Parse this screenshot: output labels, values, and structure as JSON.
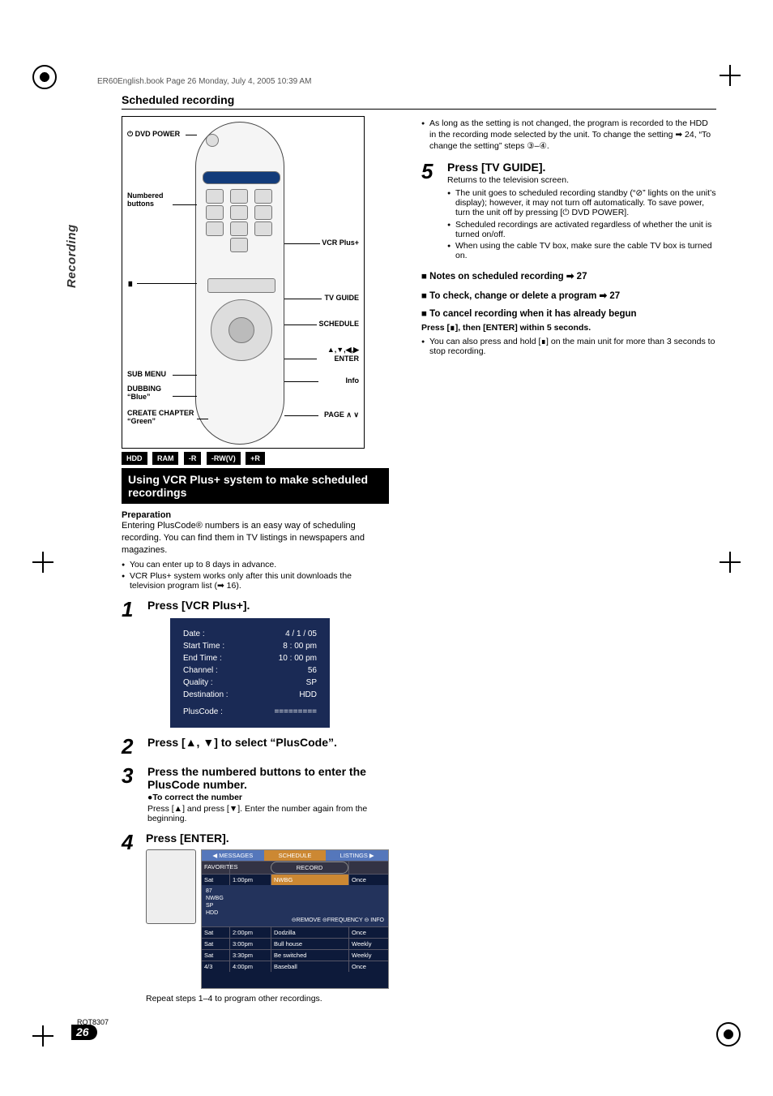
{
  "header_stamp": "ER60English.book  Page 26  Monday, July 4, 2005  10:39 AM",
  "side_tab": "Recording",
  "section_title": "Scheduled recording",
  "remote_labels": {
    "dvd_power": "⏻ DVD POWER",
    "numbered": "Numbered buttons",
    "vcrplus": "VCR Plus+",
    "stop_sym": "∎",
    "tvguide": "TV GUIDE",
    "schedule": "SCHEDULE",
    "arrows": "▲,▼,◀,▶\nENTER",
    "info": "Info",
    "submenu": "SUB MENU",
    "dubbing": "DUBBING\n“Blue”",
    "createch": "CREATE CHAPTER\n“Green”",
    "page": "PAGE ∧  ∨"
  },
  "bands": [
    "HDD",
    "RAM",
    "-R",
    "-RW(V)",
    "+R"
  ],
  "feature_bar": "Using VCR Plus+ system to make scheduled recordings",
  "prep_heading": "Preparation",
  "prep_body": "Entering PlusCode® numbers is an easy way of scheduling recording. You can find them in TV listings in newspapers and magazines.",
  "prep_bullets": [
    "You can enter up to 8 days in advance.",
    "VCR Plus+ system works only after this unit downloads the television program list (➡ 16)."
  ],
  "steps": {
    "s1": {
      "num": "1",
      "title": "Press [VCR Plus+]."
    },
    "s2": {
      "num": "2",
      "title": "Press [▲, ▼] to select “PlusCode”."
    },
    "s3": {
      "num": "3",
      "title": "Press the numbered buttons to enter the PlusCode number.",
      "sub_bold": "●To correct the number",
      "sub": "Press [▲] and press [▼]. Enter the number again from the beginning."
    },
    "s4": {
      "num": "4",
      "title": "Press [ENTER]."
    },
    "s5": {
      "num": "5",
      "title": "Press [TV GUIDE]."
    }
  },
  "osd": {
    "date_l": "Date :",
    "date_v": "4 /  1 / 05",
    "st_l": "Start Time :",
    "st_v": "8 : 00 pm",
    "et_l": "End Time :",
    "et_v": "10 : 00 pm",
    "ch_l": "Channel :",
    "ch_v": "56",
    "q_l": "Quality :",
    "q_v": "SP",
    "d_l": "Destination :",
    "d_v": "HDD",
    "pc_l": "PlusCode :",
    "pc_v": "========="
  },
  "guide": {
    "top_tabs": [
      "◀ MESSAGES",
      "SCHEDULE",
      "LISTINGS ▶"
    ],
    "fav": "FAVORITES",
    "rec": "RECORD",
    "detail_lines": [
      "87",
      "NWBG",
      "SP",
      "HDD"
    ],
    "detail_foot": "⊝REMOVE   ⊝FREQUENCY  ⊝ INFO",
    "rows": [
      {
        "d": "Sat",
        "t": "1:00pm",
        "p": "NWBG",
        "f": "Once",
        "sel": true
      },
      {
        "d": "Sat",
        "t": "2:00pm",
        "p": "Dodzilla",
        "f": "Once"
      },
      {
        "d": "Sat",
        "t": "3:00pm",
        "p": "Bull house",
        "f": "Weekly"
      },
      {
        "d": "Sat",
        "t": "3:30pm",
        "p": "Be switched",
        "f": "Weekly"
      },
      {
        "d": "4/3",
        "t": "4:00pm",
        "p": "Baseball",
        "f": "Once"
      }
    ]
  },
  "repeat_line": "Repeat steps 1–4 to program other recordings.",
  "right_top_bullet": "As long as the setting is not changed, the program is recorded to the HDD in the recording mode selected by the unit. To change the setting ➡ 24, “To change the setting” steps ③–④.",
  "s5_sub": "Returns to the television screen.",
  "s5_bullets": [
    "The unit goes to scheduled recording standby (“⊘” lights on the unit’s display); however, it may not turn off automatically. To save power, turn the unit off by pressing [⏻ DVD POWER].",
    "Scheduled recordings are activated regardless of whether the unit is turned on/off.",
    "When using the cable TV box, make sure the cable TV box is turned on."
  ],
  "notes": {
    "n1": "Notes on scheduled recording ➡ 27",
    "n2": "To check, change or delete a program ➡ 27",
    "n3": "To cancel recording when it has already begun",
    "n3_sub": "Press [∎], then [ENTER] within 5 seconds.",
    "n3_b": "You can also press and hold [∎] on the main unit for more than 3 seconds to stop recording."
  },
  "footer_code": "RQT8307",
  "page_number": "26"
}
